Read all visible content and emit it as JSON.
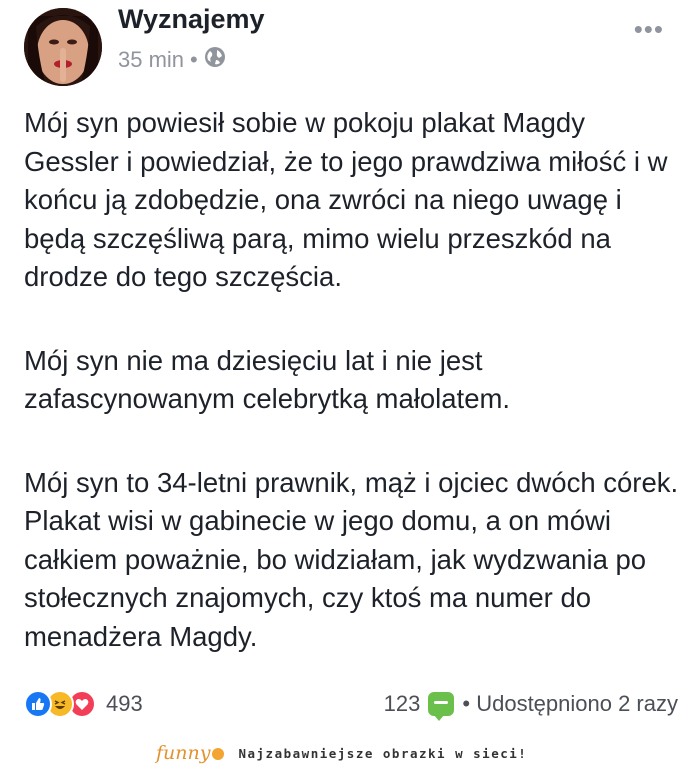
{
  "post": {
    "page_name": "Wyznajemy",
    "time": "35 min",
    "separator": "•",
    "privacy_icon": "globe-icon",
    "more_icon": "ellipsis-icon",
    "paragraphs": [
      "Mój syn powiesił sobie w pokoju plakat Magdy Gessler i powiedział, że to jego prawdziwa miłość i w końcu ją zdobędzie, ona zwróci na niego uwagę i będą szczęśliwą parą, mimo wielu przeszkód na drodze do tego szczęścia.",
      "Mój syn nie ma dziesięciu lat i nie jest zafascynowanym celebrytką małolatem.",
      "Mój syn to 34-letni prawnik, mąż i ojciec dwóch córek. Plakat wisi w gabinecie w jego domu, a on mówi całkiem poważnie, bo widziałam, jak wydzwania po stołecznych znajomych, czy ktoś ma numer do menadżera Magdy."
    ]
  },
  "stats": {
    "reactions": [
      "like-icon",
      "haha-icon",
      "love-icon"
    ],
    "reaction_count": "493",
    "comment_count": "123",
    "shares": "• Udostępniono 2 razy"
  },
  "brand": {
    "logo": "funny",
    "tagline": "Najzabawniejsze obrazki w sieci!"
  },
  "colors": {
    "like": "#1877f2",
    "haha": "#f7b928",
    "love": "#f33e58",
    "comment": "#6bc04b",
    "brand": "#e3922f"
  }
}
